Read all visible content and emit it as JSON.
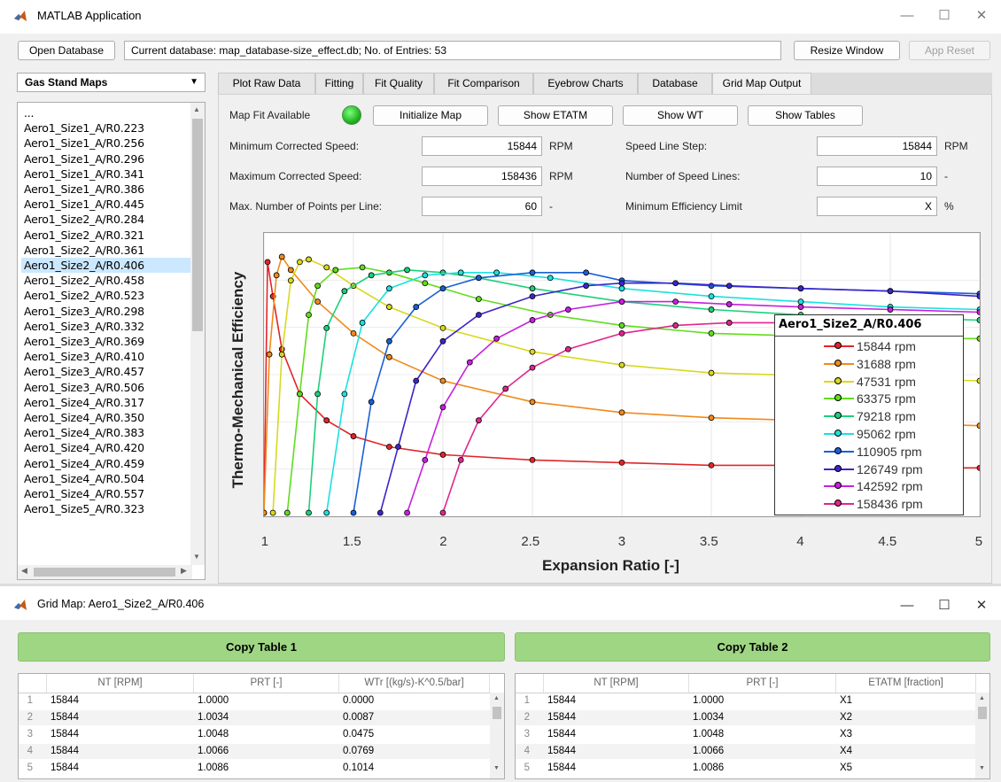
{
  "app": {
    "window_title": "MATLAB Application",
    "toolbar": {
      "open_database": "Open Database",
      "database_status": "Current database: map_database-size_effect.db;  No. of Entries: 53",
      "resize_window": "Resize Window",
      "app_reset": "App Reset"
    },
    "sidebar": {
      "dropdown_value": "Gas Stand Maps",
      "items": [
        "...",
        "Aero1_Size1_A/R0.223",
        "Aero1_Size1_A/R0.256",
        "Aero1_Size1_A/R0.296",
        "Aero1_Size1_A/R0.341",
        "Aero1_Size1_A/R0.386",
        "Aero1_Size1_A/R0.445",
        "Aero1_Size2_A/R0.284",
        "Aero1_Size2_A/R0.321",
        "Aero1_Size2_A/R0.361",
        "Aero1_Size2_A/R0.406",
        "Aero1_Size2_A/R0.458",
        "Aero1_Size2_A/R0.523",
        "Aero1_Size3_A/R0.298",
        "Aero1_Size3_A/R0.332",
        "Aero1_Size3_A/R0.369",
        "Aero1_Size3_A/R0.410",
        "Aero1_Size3_A/R0.457",
        "Aero1_Size3_A/R0.506",
        "Aero1_Size4_A/R0.317",
        "Aero1_Size4_A/R0.350",
        "Aero1_Size4_A/R0.383",
        "Aero1_Size4_A/R0.420",
        "Aero1_Size4_A/R0.459",
        "Aero1_Size4_A/R0.504",
        "Aero1_Size4_A/R0.557",
        "Aero1_Size5_A/R0.323"
      ],
      "selected_index": 10
    },
    "tabs": [
      "Plot Raw Data",
      "Fitting",
      "Fit Quality",
      "Fit Comparison",
      "Eyebrow Charts",
      "Database",
      "Grid Map Output"
    ],
    "active_tab": "Grid Map Output",
    "grid_map": {
      "map_fit_label": "Map Fit Available",
      "initialize_map": "Initialize Map",
      "show_etatm": "Show ETATM",
      "show_wt": "Show WT",
      "show_tables": "Show Tables",
      "min_speed_label": "Minimum Corrected Speed:",
      "min_speed_value": "15844",
      "min_speed_unit": "RPM",
      "max_speed_label": "Maximum Corrected Speed:",
      "max_speed_value": "158436",
      "max_speed_unit": "RPM",
      "max_points_label": "Max. Number of Points per Line:",
      "max_points_value": "60",
      "max_points_unit": "-",
      "speed_step_label": "Speed Line Step:",
      "speed_step_value": "15844",
      "speed_step_unit": "RPM",
      "num_lines_label": "Number of Speed Lines:",
      "num_lines_value": "10",
      "num_lines_unit": "-",
      "min_eff_label": "Minimum Efficiency Limit",
      "min_eff_value": "X",
      "min_eff_unit": "%"
    }
  },
  "chart_data": {
    "type": "line",
    "title": "",
    "xlabel": "Expansion Ratio [-]",
    "ylabel": "Thermo-Mechanical Efficiency",
    "xlim": [
      1,
      5
    ],
    "xticks": [
      "1",
      "1.5",
      "2",
      "2.5",
      "3",
      "3.5",
      "4",
      "4.5",
      "5"
    ],
    "yticks_visible": false,
    "grid": true,
    "legend_title": "Aero1_Size2_A/R0.406",
    "legend_position": "right",
    "y_units": "normalized 0-1 (axis unlabeled)",
    "series": [
      {
        "name": "15844 rpm",
        "color": "#e0262a",
        "x": [
          1.0,
          1.02,
          1.05,
          1.1,
          1.2,
          1.35,
          1.5,
          1.7,
          2.0,
          2.5,
          3.0,
          3.5,
          4.0,
          4.5,
          5.0
        ],
        "y": [
          0.0,
          0.95,
          0.82,
          0.62,
          0.45,
          0.35,
          0.29,
          0.25,
          0.22,
          0.2,
          0.19,
          0.18,
          0.18,
          0.17,
          0.17
        ]
      },
      {
        "name": "31688 rpm",
        "color": "#f08a1c",
        "x": [
          1.0,
          1.03,
          1.07,
          1.1,
          1.15,
          1.3,
          1.5,
          1.7,
          2.0,
          2.5,
          3.0,
          3.5,
          4.0,
          4.5,
          5.0
        ],
        "y": [
          0.0,
          0.6,
          0.9,
          0.97,
          0.92,
          0.8,
          0.68,
          0.59,
          0.5,
          0.42,
          0.38,
          0.36,
          0.35,
          0.34,
          0.33
        ]
      },
      {
        "name": "47531 rpm",
        "color": "#d8d820",
        "x": [
          1.05,
          1.1,
          1.15,
          1.2,
          1.25,
          1.35,
          1.5,
          1.7,
          2.0,
          2.5,
          3.0,
          3.5,
          4.0,
          4.5,
          5.0
        ],
        "y": [
          0.0,
          0.6,
          0.88,
          0.95,
          0.96,
          0.93,
          0.86,
          0.78,
          0.7,
          0.61,
          0.56,
          0.53,
          0.52,
          0.51,
          0.5
        ]
      },
      {
        "name": "63375 rpm",
        "color": "#62dc1e",
        "x": [
          1.13,
          1.2,
          1.25,
          1.3,
          1.4,
          1.55,
          1.7,
          1.9,
          2.2,
          2.6,
          3.0,
          3.5,
          4.0,
          4.5,
          5.0
        ],
        "y": [
          0.0,
          0.45,
          0.75,
          0.86,
          0.92,
          0.93,
          0.91,
          0.87,
          0.81,
          0.75,
          0.71,
          0.68,
          0.67,
          0.66,
          0.66
        ]
      },
      {
        "name": "79218 rpm",
        "color": "#1cd07a",
        "x": [
          1.25,
          1.3,
          1.35,
          1.45,
          1.6,
          1.8,
          2.0,
          2.2,
          2.5,
          3.0,
          3.5,
          4.0,
          4.5,
          5.0
        ],
        "y": [
          0.0,
          0.45,
          0.7,
          0.84,
          0.9,
          0.92,
          0.91,
          0.89,
          0.85,
          0.8,
          0.77,
          0.75,
          0.74,
          0.73
        ]
      },
      {
        "name": "95062 rpm",
        "color": "#1ce0e0",
        "x": [
          1.35,
          1.45,
          1.55,
          1.7,
          1.9,
          2.1,
          2.3,
          2.6,
          3.0,
          3.5,
          4.0,
          4.5,
          5.0
        ],
        "y": [
          0.0,
          0.45,
          0.72,
          0.85,
          0.9,
          0.91,
          0.91,
          0.89,
          0.85,
          0.82,
          0.8,
          0.78,
          0.77
        ]
      },
      {
        "name": "110905 rpm",
        "color": "#1a5fd8",
        "x": [
          1.5,
          1.6,
          1.7,
          1.85,
          2.0,
          2.2,
          2.5,
          2.8,
          3.0,
          3.5,
          4.0,
          4.5,
          5.0
        ],
        "y": [
          0.0,
          0.42,
          0.65,
          0.78,
          0.85,
          0.89,
          0.91,
          0.91,
          0.88,
          0.86,
          0.85,
          0.84,
          0.83
        ]
      },
      {
        "name": "126749 rpm",
        "color": "#3c26c8",
        "x": [
          1.65,
          1.75,
          1.85,
          2.0,
          2.2,
          2.5,
          2.8,
          3.0,
          3.3,
          3.6,
          4.0,
          4.5,
          5.0
        ],
        "y": [
          0.0,
          0.25,
          0.5,
          0.65,
          0.75,
          0.82,
          0.86,
          0.87,
          0.87,
          0.86,
          0.85,
          0.84,
          0.82
        ]
      },
      {
        "name": "142592 rpm",
        "color": "#c81ee0",
        "x": [
          1.8,
          1.9,
          2.0,
          2.15,
          2.3,
          2.5,
          2.7,
          3.0,
          3.3,
          3.6,
          4.0,
          4.5,
          5.0
        ],
        "y": [
          0.0,
          0.2,
          0.4,
          0.57,
          0.66,
          0.73,
          0.77,
          0.8,
          0.8,
          0.79,
          0.78,
          0.77,
          0.76
        ]
      },
      {
        "name": "158436 rpm",
        "color": "#e0268c",
        "x": [
          2.0,
          2.1,
          2.2,
          2.35,
          2.5,
          2.7,
          3.0,
          3.3,
          3.6,
          3.9
        ],
        "y": [
          0.0,
          0.2,
          0.35,
          0.47,
          0.55,
          0.62,
          0.68,
          0.71,
          0.72,
          0.72
        ]
      }
    ]
  },
  "grid_window": {
    "title": "Grid Map: Aero1_Size2_A/R0.406",
    "copy_table_1": "Copy Table 1",
    "copy_table_2": "Copy Table 2",
    "table1": {
      "headers": [
        "NT [RPM]",
        "PRT [-]",
        "WTr [(kg/s)-K^0.5/bar]"
      ],
      "rows": [
        [
          "1",
          "15844",
          "1.0000",
          "0.0000"
        ],
        [
          "2",
          "15844",
          "1.0034",
          "0.0087"
        ],
        [
          "3",
          "15844",
          "1.0048",
          "0.0475"
        ],
        [
          "4",
          "15844",
          "1.0066",
          "0.0769"
        ],
        [
          "5",
          "15844",
          "1.0086",
          "0.1014"
        ]
      ]
    },
    "table2": {
      "headers": [
        "NT [RPM]",
        "PRT [-]",
        "ETATM [fraction]"
      ],
      "rows": [
        [
          "1",
          "15844",
          "1.0000",
          "X1"
        ],
        [
          "2",
          "15844",
          "1.0034",
          "X2"
        ],
        [
          "3",
          "15844",
          "1.0048",
          "X3"
        ],
        [
          "4",
          "15844",
          "1.0066",
          "X4"
        ],
        [
          "5",
          "15844",
          "1.0086",
          "X5"
        ]
      ]
    }
  },
  "window_controls": {
    "minimize": "—",
    "maximize": "☐",
    "close": "✕"
  }
}
